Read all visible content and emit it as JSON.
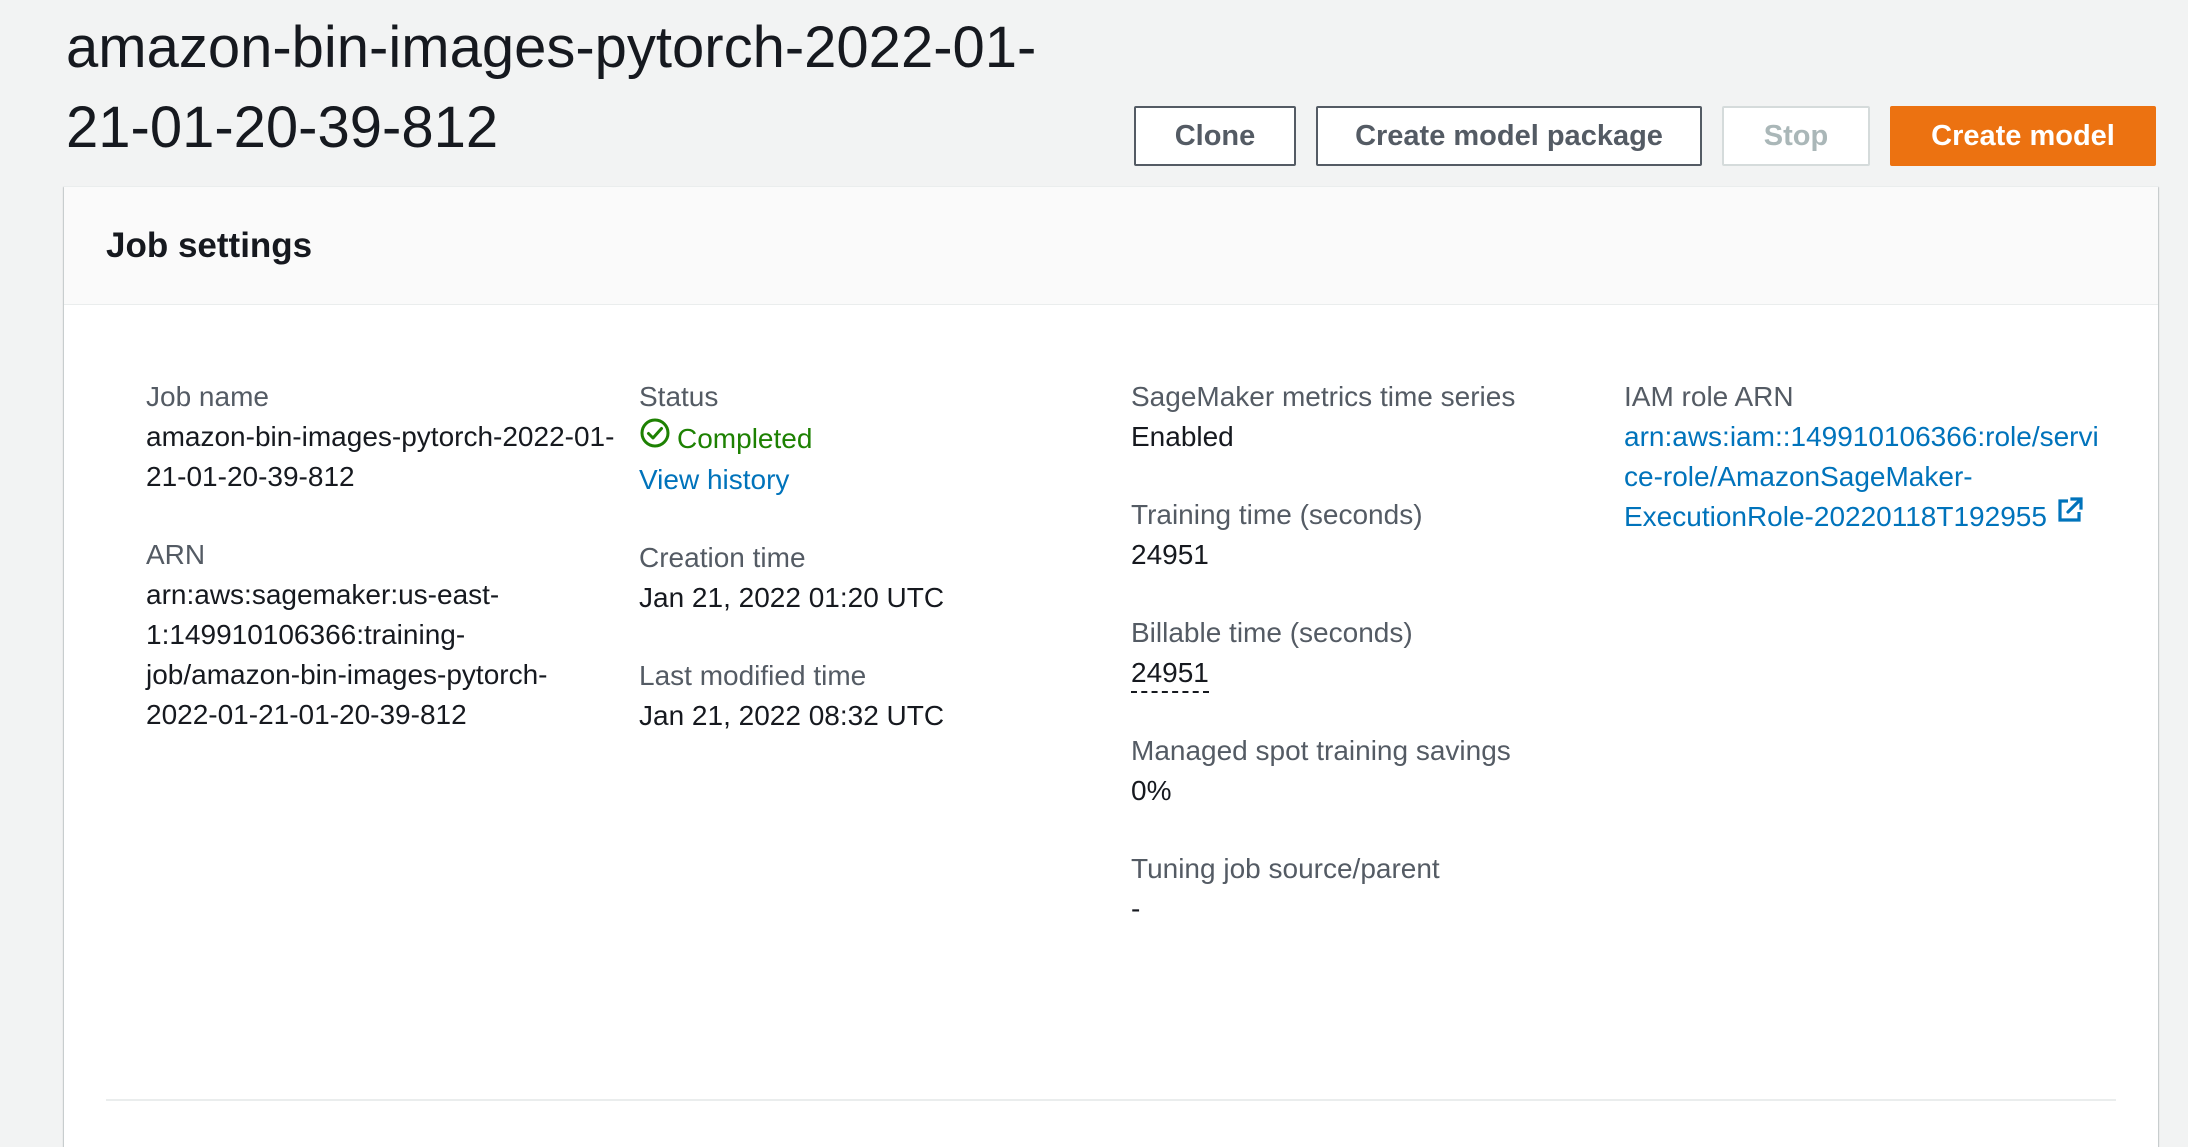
{
  "header": {
    "title": "amazon-bin-images-pytorch-2022-01-21-01-20-39-812"
  },
  "actions": {
    "clone_label": "Clone",
    "create_package_label": "Create model package",
    "stop_label": "Stop",
    "create_model_label": "Create model"
  },
  "panel": {
    "title": "Job settings"
  },
  "job": {
    "job_name_label": "Job name",
    "job_name_value": "amazon-bin-images-pytorch-2022-01-21-01-20-39-812",
    "arn_label": "ARN",
    "arn_value": "arn:aws:sagemaker:us-east-1:149910106366:training-job/amazon-bin-images-pytorch-2022-01-21-01-20-39-812",
    "status_label": "Status",
    "status_value": "Completed",
    "view_history_link": "View history",
    "creation_time_label": "Creation time",
    "creation_time_value": "Jan 21, 2022 01:20 UTC",
    "last_modified_label": "Last modified time",
    "last_modified_value": "Jan 21, 2022 08:32 UTC",
    "metrics_label": "SageMaker metrics time series",
    "metrics_value": "Enabled",
    "training_time_label": "Training time (seconds)",
    "training_time_value": "24951",
    "billable_time_label": "Billable time (seconds)",
    "billable_time_value": "24951",
    "spot_savings_label": "Managed spot training savings",
    "spot_savings_value": "0%",
    "tuning_source_label": "Tuning job source/parent",
    "tuning_source_value": "-",
    "iam_role_label": "IAM role ARN",
    "iam_role_value": "arn:aws:iam::149910106366:role/service-role/AmazonSageMaker-ExecutionRole-20220118T192955"
  },
  "colors": {
    "primary_button": "#ec7211",
    "link": "#0073bb",
    "success": "#1d8102"
  },
  "icons": {
    "status": "check-circle-icon",
    "external": "external-link-icon"
  }
}
